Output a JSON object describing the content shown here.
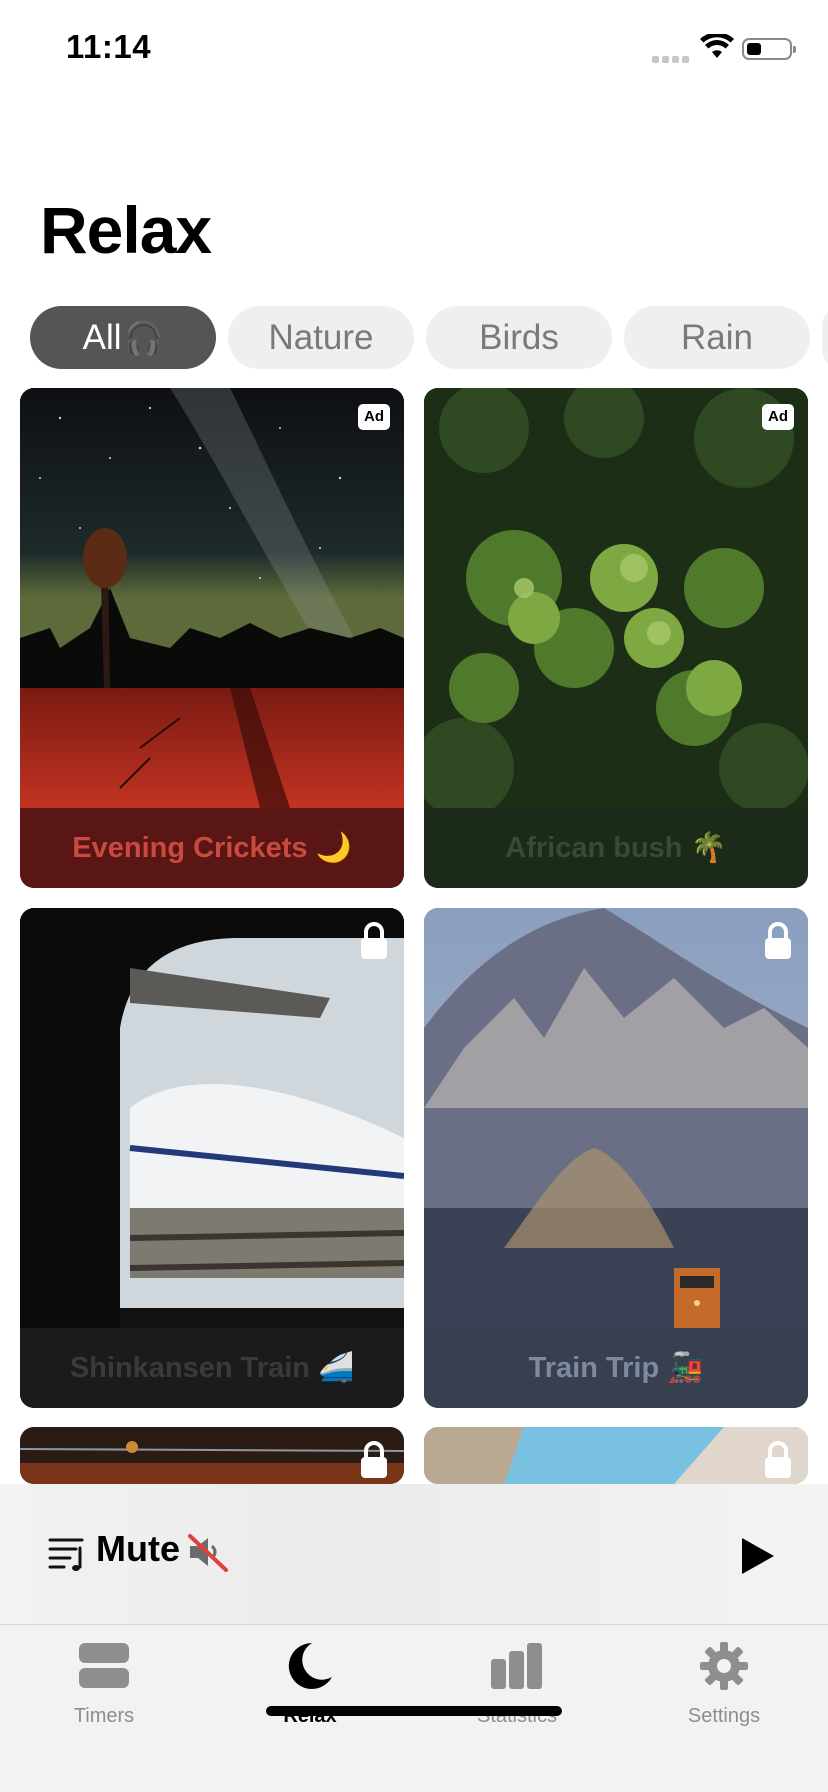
{
  "status_bar": {
    "time": "11:14",
    "icons": [
      "signal-dots",
      "wifi-icon",
      "battery-icon"
    ]
  },
  "page": {
    "title": "Relax"
  },
  "categories": [
    {
      "label": "All",
      "emoji": "🎧",
      "selected": true
    },
    {
      "label": "Nature",
      "emoji": "",
      "selected": false
    },
    {
      "label": "Birds",
      "emoji": "",
      "selected": false
    },
    {
      "label": "Rain",
      "emoji": "",
      "selected": false
    }
  ],
  "sounds": [
    {
      "title": "Evening Crickets 🌙",
      "badge": "Ad",
      "locked": false,
      "caption_bg": "#5a1614",
      "caption_color": "#c94b3f"
    },
    {
      "title": "African bush 🌴",
      "badge": "Ad",
      "locked": false,
      "caption_bg": "#1c2a1a",
      "caption_color": "#3b4a36"
    },
    {
      "title": "Shinkansen Train 🚄",
      "badge": "",
      "locked": true,
      "caption_bg": "#1b1b1b",
      "caption_color": "#3a3a3a"
    },
    {
      "title": "Train Trip 🚂",
      "badge": "",
      "locked": true,
      "caption_bg": "#38404f",
      "caption_color": "#7f8aa0"
    }
  ],
  "now_playing": {
    "title": "Mute",
    "emoji_icon": "muted-speaker-icon",
    "controls": [
      "playlist-icon",
      "play-icon"
    ]
  },
  "tabs": [
    {
      "label": "Timers",
      "icon": "timers-icon",
      "active": false
    },
    {
      "label": "Relax",
      "icon": "moon-icon",
      "active": true
    },
    {
      "label": "Statistics",
      "icon": "bar-chart-icon",
      "active": false
    },
    {
      "label": "Settings",
      "icon": "gear-icon",
      "active": false
    }
  ],
  "colors": {
    "chip_active": "#555555",
    "chip_inactive": "#efefef",
    "tab_active": "#000000",
    "tab_inactive": "#8e8e8e"
  }
}
